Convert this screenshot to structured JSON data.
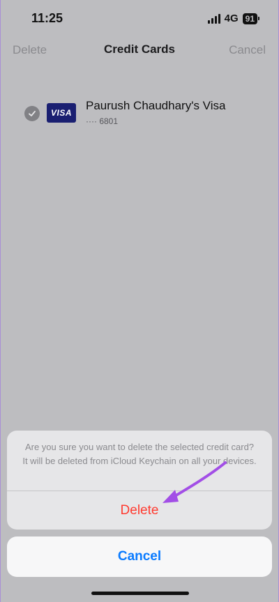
{
  "status_bar": {
    "time": "11:25",
    "network": "4G",
    "battery": "91"
  },
  "nav": {
    "left_label": "Delete",
    "title": "Credit Cards",
    "right_label": "Cancel"
  },
  "card": {
    "logo_text": "VISA",
    "name": "Paurush Chaudhary's Visa",
    "number": "···· 6801",
    "selected": true
  },
  "action_sheet": {
    "message": "Are you sure you want to delete the selected credit card? It will be deleted from iCloud Keychain on all your devices.",
    "delete_label": "Delete",
    "cancel_label": "Cancel"
  },
  "colors": {
    "destructive": "#ff3b30",
    "accent": "#0a7bff",
    "annotation_arrow": "#a24ee6"
  },
  "icons": {
    "checkmark": "checkmark-icon",
    "signal": "signal-icon",
    "battery": "battery-icon"
  }
}
